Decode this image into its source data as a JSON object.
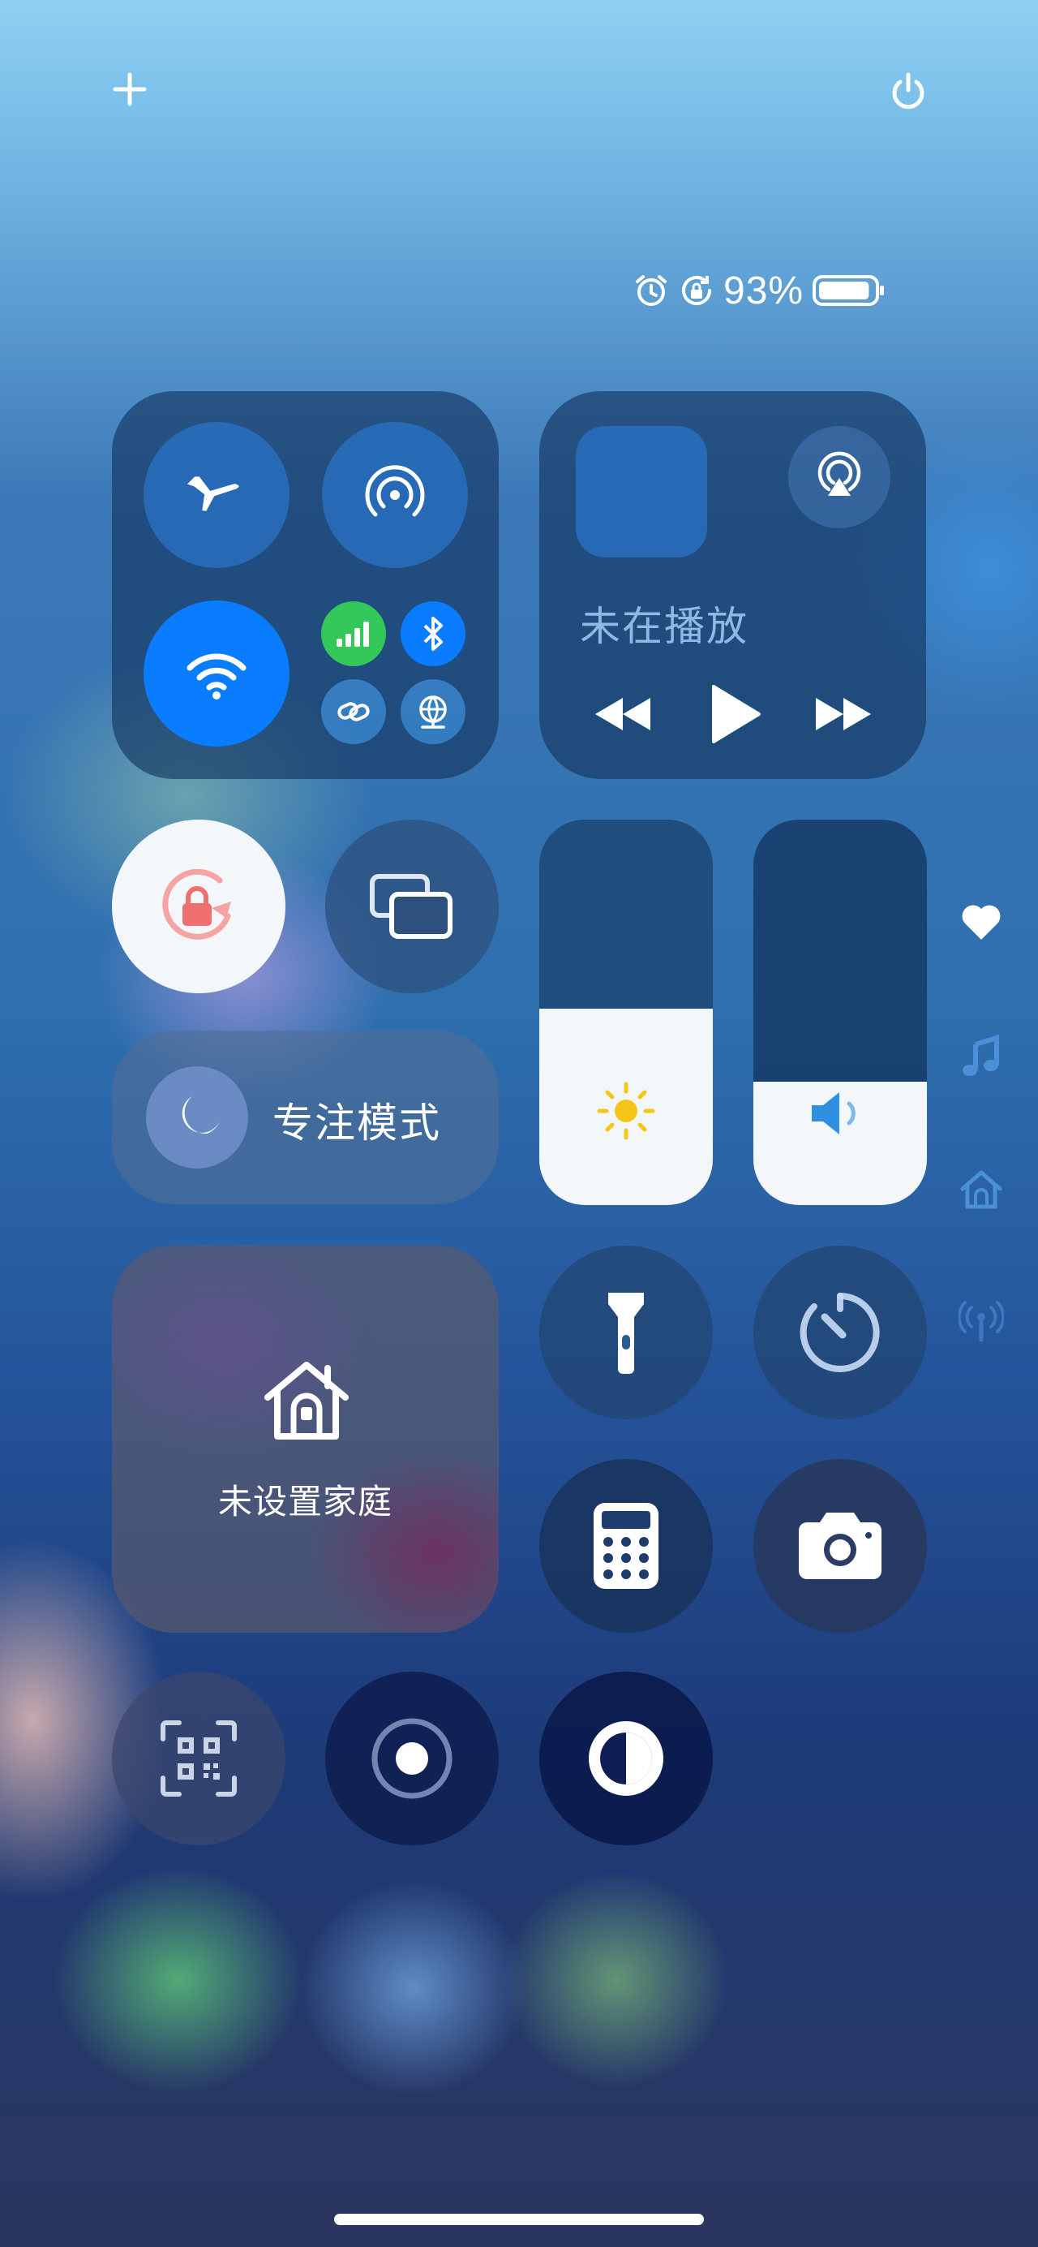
{
  "status_bar": {
    "battery_percent": "93%",
    "battery_level": 0.93
  },
  "media": {
    "now_playing": "未在播放"
  },
  "focus": {
    "label": "专注模式"
  },
  "home": {
    "label": "未设置家庭"
  },
  "sliders": {
    "brightness_level": 0.51,
    "volume_level": 0.32
  },
  "toggles": {
    "airplane_mode": false,
    "airdrop": false,
    "wifi": true,
    "cellular": true,
    "bluetooth": true,
    "orientation_lock": true
  },
  "colors": {
    "accent_blue": "#0a7cff",
    "cellular_green": "#34c759",
    "lock_red": "#f07070",
    "brightness_yellow": "#f5c518",
    "volume_blue": "#2f8fe0"
  },
  "icons": [
    "plus-icon",
    "power-icon",
    "alarm-icon",
    "rotation-lock-icon",
    "battery-icon",
    "airplane-icon",
    "airdrop-icon",
    "wifi-icon",
    "cellular-icon",
    "bluetooth-icon",
    "personal-hotspot-icon",
    "vpn-icon",
    "airplay-icon",
    "rewind-icon",
    "play-icon",
    "fast-forward-icon",
    "screen-mirroring-icon",
    "moon-icon",
    "sun-icon",
    "speaker-icon",
    "flashlight-icon",
    "timer-icon",
    "home-icon",
    "calculator-icon",
    "camera-icon",
    "qr-code-icon",
    "screen-record-icon",
    "dark-mode-icon",
    "heart-icon",
    "music-note-icon",
    "home-sidebar-icon",
    "antenna-icon"
  ]
}
